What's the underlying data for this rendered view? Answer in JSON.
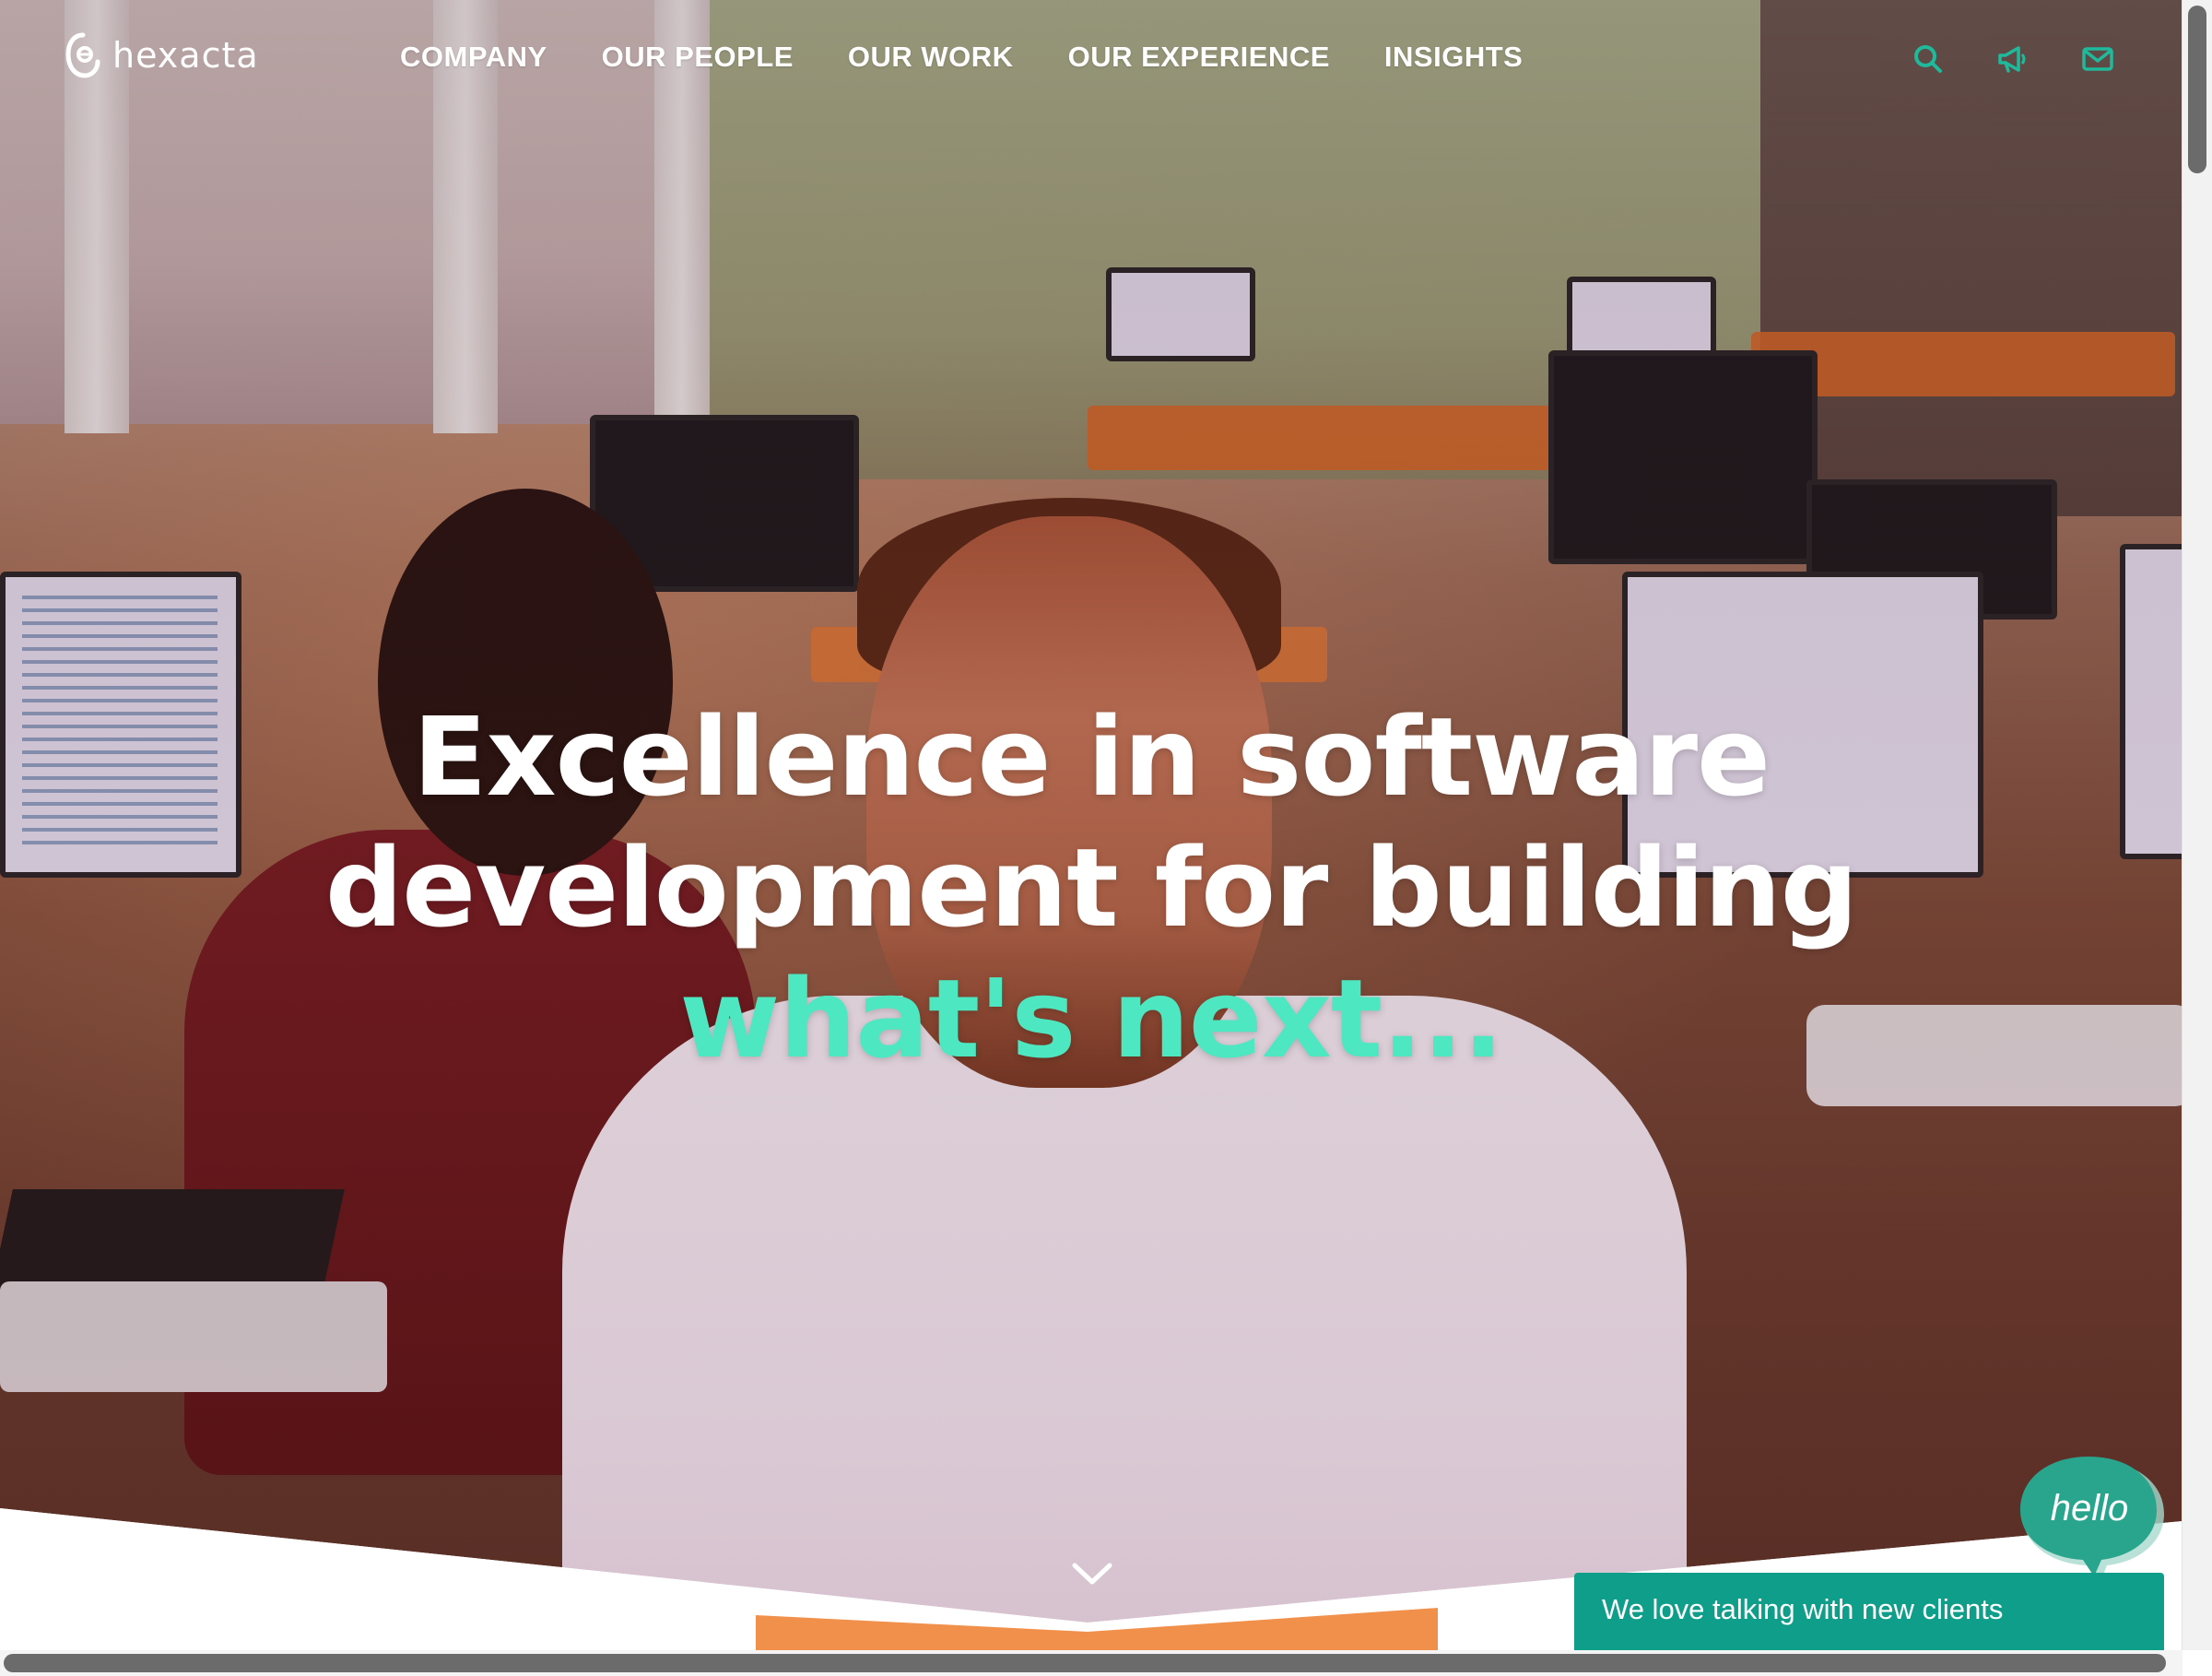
{
  "brand": {
    "name": "hexacta",
    "accent_color": "#4de8c2",
    "chat_color": "#0e9e8a"
  },
  "nav": {
    "items": [
      {
        "label": "COMPANY"
      },
      {
        "label": "OUR PEOPLE"
      },
      {
        "label": "OUR WORK"
      },
      {
        "label": "OUR EXPERIENCE"
      },
      {
        "label": "INSIGHTS"
      }
    ]
  },
  "header_icons": [
    {
      "name": "search-icon"
    },
    {
      "name": "megaphone-icon"
    },
    {
      "name": "envelope-icon"
    }
  ],
  "hero": {
    "line1": "Excellence in software",
    "line2": "development for building",
    "line3": "what's next..."
  },
  "chat": {
    "bubble_label": "hello",
    "bar_text": "We love talking with new clients"
  }
}
